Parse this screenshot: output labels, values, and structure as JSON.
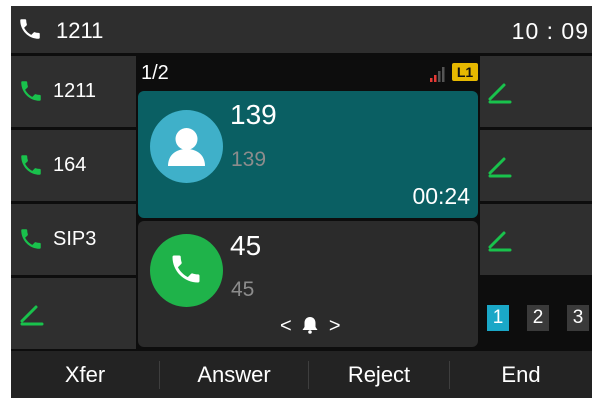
{
  "status_bar": {
    "account": "1211",
    "time": "10 : 09"
  },
  "line_keys": [
    {
      "label": "1211",
      "icon": "phone-icon"
    },
    {
      "label": "164",
      "icon": "phone-icon"
    },
    {
      "label": "SIP3",
      "icon": "phone-icon"
    },
    {
      "label": "",
      "icon": "edit-icon"
    }
  ],
  "right_keys": [
    {
      "icon": "edit-icon"
    },
    {
      "icon": "edit-icon"
    },
    {
      "icon": "edit-icon"
    }
  ],
  "call_area": {
    "page_indicator": "1/2",
    "line_badge": "L1",
    "calls": [
      {
        "name": "139",
        "number": "139",
        "duration": "00:24",
        "state": "active"
      },
      {
        "name": "45",
        "number": "45",
        "state": "incoming"
      }
    ],
    "nav_left": "<",
    "nav_right": ">"
  },
  "page_buttons": [
    "1",
    "2",
    "3"
  ],
  "active_page": "1",
  "softkeys": [
    "Xfer",
    "Answer",
    "Reject",
    "End"
  ],
  "colors": {
    "active_call": "#0a5f63",
    "contact_avatar": "#3fb0c9",
    "incoming_avatar": "#1fb34a",
    "line_badge": "#e6b800",
    "active_page": "#1aa7c7",
    "line_icon": "#19c24c"
  }
}
